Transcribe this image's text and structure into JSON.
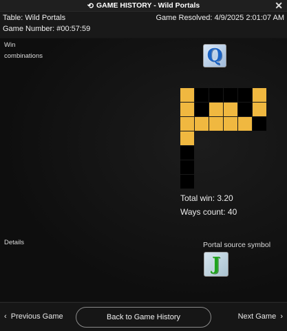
{
  "window": {
    "title": "GAME HISTORY - Wild Portals",
    "close_glyph": "✕",
    "history_icon": "history-icon"
  },
  "info": {
    "table": "Table: Wild Portals",
    "game_number": "Game Number: #00:57:59",
    "resolved": "Game Resolved: 4/9/2025 2:01:07 AM"
  },
  "win": {
    "label_line1": "Win",
    "label_line2": "combinations"
  },
  "details_label": "Details",
  "symbols": {
    "win_symbol": "Q",
    "portal_symbol": "J"
  },
  "grid": {
    "rows": [
      [
        1,
        0,
        0,
        0,
        0,
        1
      ],
      [
        1,
        0,
        1,
        1,
        0,
        1
      ],
      [
        1,
        1,
        1,
        1,
        1,
        0
      ],
      [
        1,
        -1,
        -1,
        -1,
        -1,
        -1
      ],
      [
        0,
        -1,
        -1,
        -1,
        -1,
        -1
      ],
      [
        0,
        -1,
        -1,
        -1,
        -1,
        -1
      ],
      [
        0,
        -1,
        -1,
        -1,
        -1,
        -1
      ]
    ],
    "colors": {
      "on": "#f0b840",
      "off": "#000000"
    }
  },
  "totals": {
    "total_win": "Total win: 3.20",
    "ways_count": "Ways count: 40"
  },
  "portal_source_label": "Portal source symbol",
  "nav": {
    "prev_icon": "‹",
    "prev_label": "Previous Game",
    "back_label": "Back to Game History",
    "next_label": "Next Game",
    "next_icon": "›"
  }
}
